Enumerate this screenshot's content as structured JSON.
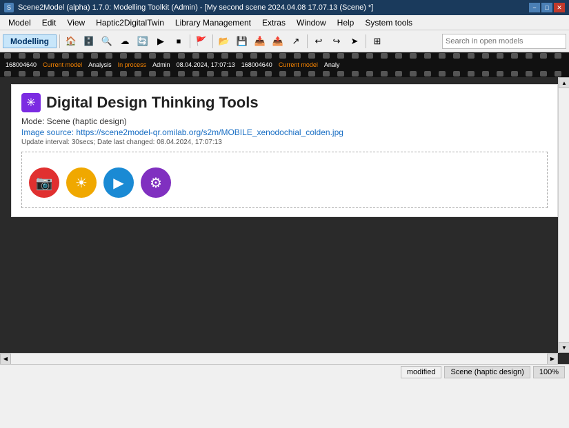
{
  "titleBar": {
    "icon": "S",
    "title": "Scene2Model (alpha) 1.7.0: Modelling Toolkit (Admin) - [My second scene 2024.04.08 17.07.13 (Scene) *]",
    "controls": [
      "−",
      "□",
      "✕"
    ]
  },
  "menuBar": {
    "items": [
      "Model",
      "Edit",
      "View",
      "Haptic2DigitalTwin",
      "Library Management",
      "Extras",
      "Window",
      "Help",
      "System tools"
    ]
  },
  "toolbar": {
    "mode_label": "Modelling",
    "search_placeholder": "Search in open models"
  },
  "filmstrip": {
    "segments": [
      {
        "id": "168004640",
        "label": "Current model",
        "analysis": "Analysis",
        "status": "In process",
        "admin": "Admin",
        "datetime": "08.04.2024, 17:07:13",
        "id2": "168004640",
        "label2": "Current model",
        "analysis2": "Analy"
      }
    ]
  },
  "canvas": {
    "appIcon": "✳",
    "appTitle": "Digital Design Thinking Tools",
    "mode": "Mode: Scene (haptic design)",
    "imageSource": "Image source: https://scene2model-qr.omilab.org/s2m/MOBILE_xenodochial_colden.jpg",
    "updateInfo": "Update interval: 30secs; Date last changed: 08.04.2024, 17:07:13",
    "buttons": [
      {
        "id": "camera",
        "icon": "📷",
        "class": "btn-camera",
        "label": "camera-button"
      },
      {
        "id": "sun",
        "icon": "☀",
        "class": "btn-sun",
        "label": "sun-button"
      },
      {
        "id": "play",
        "icon": "▶",
        "class": "btn-play",
        "label": "play-button"
      },
      {
        "id": "settings",
        "icon": "⚙",
        "class": "btn-settings",
        "label": "settings-button"
      }
    ]
  },
  "statusBar": {
    "modified": "modified",
    "scene": "Scene (haptic design)",
    "zoom": "100%"
  }
}
